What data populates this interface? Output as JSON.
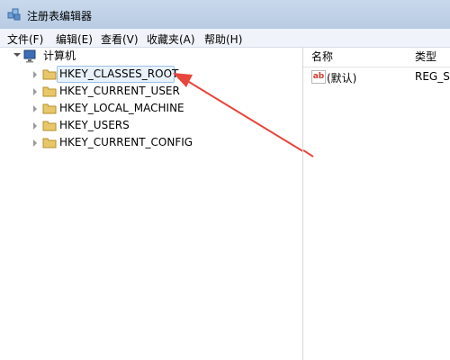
{
  "window": {
    "title": "注册表编辑器"
  },
  "menu": [
    {
      "label": "文件(F)"
    },
    {
      "label": "编辑(E)"
    },
    {
      "label": "查看(V)"
    },
    {
      "label": "收藏夹(A)"
    },
    {
      "label": "帮助(H)"
    }
  ],
  "tree": {
    "root": "计算机",
    "children": [
      {
        "label": "HKEY_CLASSES_ROOT",
        "selected": true
      },
      {
        "label": "HKEY_CURRENT_USER"
      },
      {
        "label": "HKEY_LOCAL_MACHINE"
      },
      {
        "label": "HKEY_USERS"
      },
      {
        "label": "HKEY_CURRENT_CONFIG"
      }
    ]
  },
  "list": {
    "columns": [
      "名称",
      "类型"
    ],
    "rows": [
      {
        "icon": "ab-string-icon",
        "name": "(默认)",
        "type": "REG_SZ"
      }
    ]
  },
  "colors": {
    "arrow": "#e8463b",
    "folder": "#e7c76a",
    "selection_border": "#9cc1e8",
    "selection_bg": "#e9f2fb"
  }
}
